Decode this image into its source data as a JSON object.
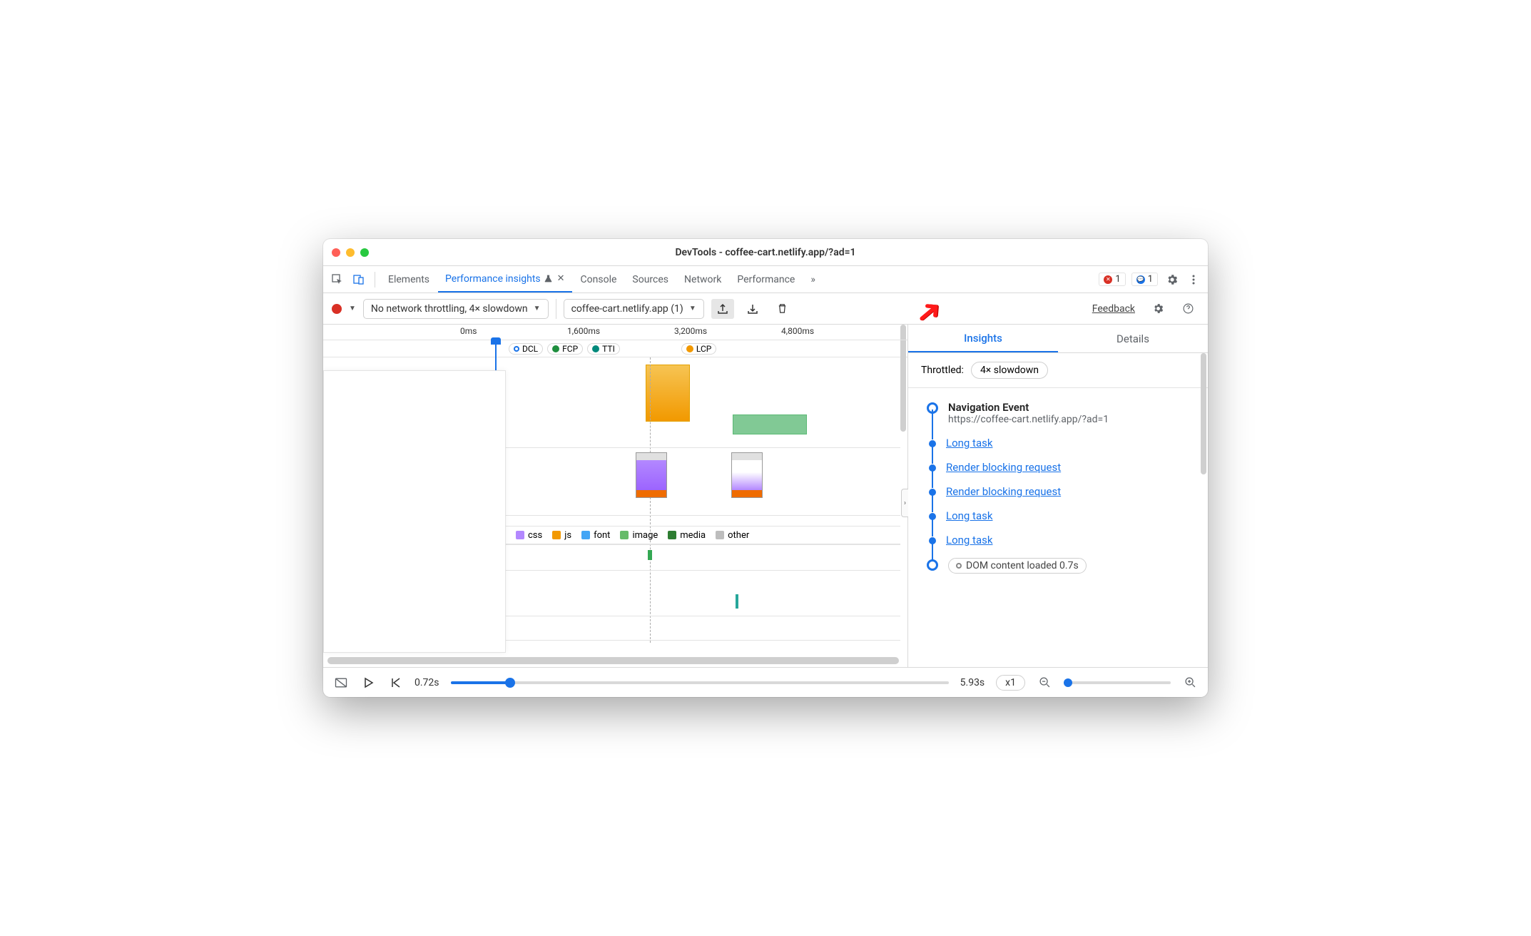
{
  "window": {
    "title": "DevTools - coffee-cart.netlify.app/?ad=1"
  },
  "tabs": {
    "elements": "Elements",
    "perf_insights": "Performance insights",
    "console": "Console",
    "sources": "Sources",
    "network": "Network",
    "performance": "Performance",
    "more": "»",
    "errors": "1",
    "issues": "1"
  },
  "toolbar": {
    "throttle_select": "No network throttling, 4× slowdown",
    "recording_select": "coffee-cart.netlify.app (1)",
    "feedback": "Feedback"
  },
  "timeline": {
    "ticks": [
      "0ms",
      "1,600ms",
      "3,200ms",
      "4,800ms"
    ],
    "markers": {
      "dcl": "DCL",
      "fcp": "FCP",
      "tti": "TTI",
      "lcp": "LCP"
    },
    "legend": {
      "css": "css",
      "js": "js",
      "font": "font",
      "image": "image",
      "media": "media",
      "other": "other"
    }
  },
  "sidebar": {
    "tabs": {
      "insights": "Insights",
      "details": "Details"
    },
    "throttled_label": "Throttled:",
    "throttled_value": "4× slowdown",
    "nav_title": "Navigation Event",
    "nav_url": "https://coffee-cart.netlify.app/?ad=1",
    "items": [
      "Long task",
      "Render blocking request",
      "Render blocking request",
      "Long task",
      "Long task"
    ],
    "dcl": "DOM content loaded 0.7s"
  },
  "footer": {
    "current_time": "0.72s",
    "total_time": "5.93s",
    "speed": "x1"
  }
}
